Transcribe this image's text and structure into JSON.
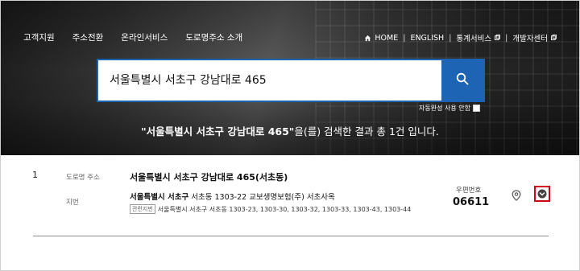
{
  "nav": {
    "left_items": [
      "고객지원",
      "주소전환",
      "온라인서비스",
      "도로명주소 소개"
    ],
    "right": {
      "home": "HOME",
      "english": "ENGLISH",
      "stats": "통계서비스",
      "dev": "개발자센터"
    }
  },
  "search": {
    "query": "서울특별시 서초구 강남대로 465",
    "autocomplete_label": "자동완성 사용 안함"
  },
  "summary": {
    "query_quoted": "\"서울특별시 서초구 강남대로 465\"",
    "rest": "을(를) 검색한 결과 총 1건 입니다."
  },
  "result": {
    "index": "1",
    "road_label": "도로명 주소",
    "jibun_label": "지번",
    "road_address": "서울특별시 서초구 강남대로 465(서초동)",
    "jibun_address_bold": "서울특별시 서초구",
    "jibun_address_rest": " 서초동 1303-22 교보생명보험(주) 서초사옥",
    "related_badge": "관련지번",
    "related_text": "서울특별시 서초구 서초동 1303-23, 1303-30, 1303-32, 1303-33, 1303-43, 1303-44",
    "zip_label": "우편번호",
    "zip_code": "06611"
  },
  "colors": {
    "accent": "#1e64b4",
    "highlight_border": "#d0021b"
  }
}
